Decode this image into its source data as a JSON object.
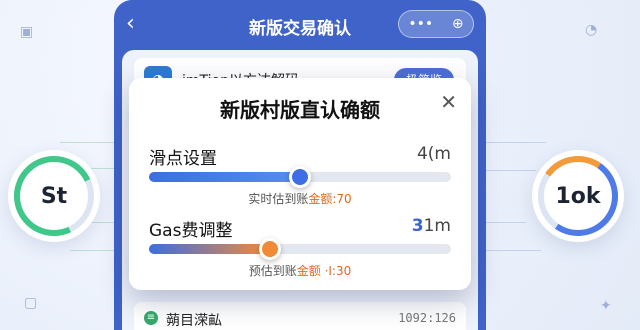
{
  "header": {
    "title": "新版交易确认",
    "more_glyph": "•••",
    "target_glyph": "⊕",
    "back_glyph": "‹"
  },
  "app_card": {
    "name": "imTion以方达解码",
    "button": "极简览"
  },
  "modal": {
    "title": "新版村版直认确额",
    "close_glyph": "✕",
    "slippage": {
      "label": "滑点设置",
      "value": "4(m",
      "level": 0.5,
      "note_prefix": "实时估到账",
      "note_highlight": "金额:70"
    },
    "gas": {
      "label": "Gas费调整",
      "value_hl": "3",
      "value_rest": "1m",
      "level": 0.4,
      "note_prefix": "预估到账",
      "note_highlight": "金额 ·I:30"
    }
  },
  "bottom_item": {
    "label": "蒴目溁畆",
    "value": "1092:126",
    "icon": "≡"
  },
  "left_ring": {
    "text": "St"
  },
  "right_ring": {
    "text": "1ok"
  },
  "colors": {
    "primary": "#3f63c9",
    "accent_blue": "#3d6ee6",
    "accent_orange": "#f18a37",
    "green": "#3fc88a"
  }
}
